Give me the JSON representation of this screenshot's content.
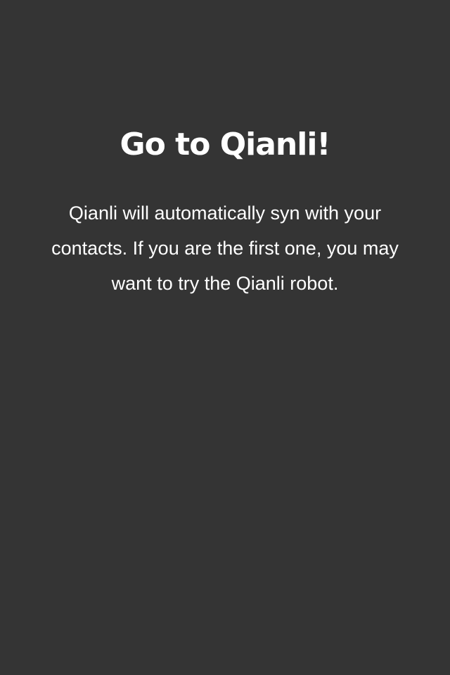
{
  "screen": {
    "background_color": "#343434",
    "text_color": "#ffffff",
    "title": "Go to Qianli!",
    "description": "Qianli will automatically syn with your contacts. If you are the first one, you may want to try the Qianli robot."
  }
}
